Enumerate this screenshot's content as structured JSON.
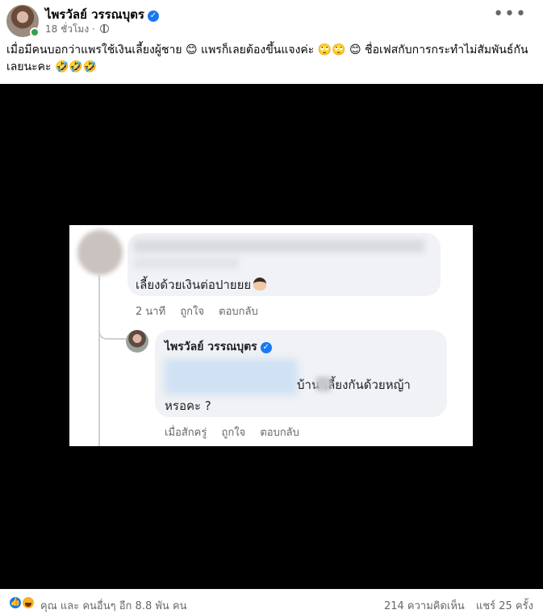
{
  "post": {
    "author": "ไพรวัลย์ วรรณบุตร",
    "time": "18 ชั่วโมง",
    "separator": "·",
    "more_label": "•••",
    "caption": "เมื่อมีคนบอกว่าแพรใช้เงินเลี้ยงผู้ชาย 😊 แพรก็เลยต้องขึ้นแจงค่ะ 🙄🙄 😊 ชื่อเฟสกับการกระทำไม่สัมพันธ์กันเลยนะคะ 🤣🤣🤣"
  },
  "screenshot": {
    "comment": {
      "text": "เลี้ยงด้วยเงินต่อปายยย",
      "time": "2 นาที",
      "like": "ถูกใจ",
      "reply": "ตอบกลับ"
    },
    "reply": {
      "author": "ไพรวัลย์ วรรณบุตร",
      "text_line1": "บ้าน  เลี้ยงกันด้วยหญ้า",
      "text_line2": "หรอคะ ?",
      "time": "เมื่อสักครู่",
      "like": "ถูกใจ",
      "reply": "ตอบกลับ"
    }
  },
  "footer": {
    "reactors": "คุณ และ คนอื่นๆ อีก 8.8 พัน คน",
    "comments": "214 ความคิดเห็น",
    "shares": "แชร์ 25 ครั้ง"
  },
  "colors": {
    "accent": "#1877f2",
    "online": "#31a24c",
    "muted": "#65676b",
    "bubble": "#f0f2f5"
  },
  "icons": {
    "verified": "verified-badge-icon",
    "globe": "globe-icon",
    "more": "more-options-icon",
    "like": "like-reaction-icon",
    "haha": "haha-reaction-icon"
  }
}
